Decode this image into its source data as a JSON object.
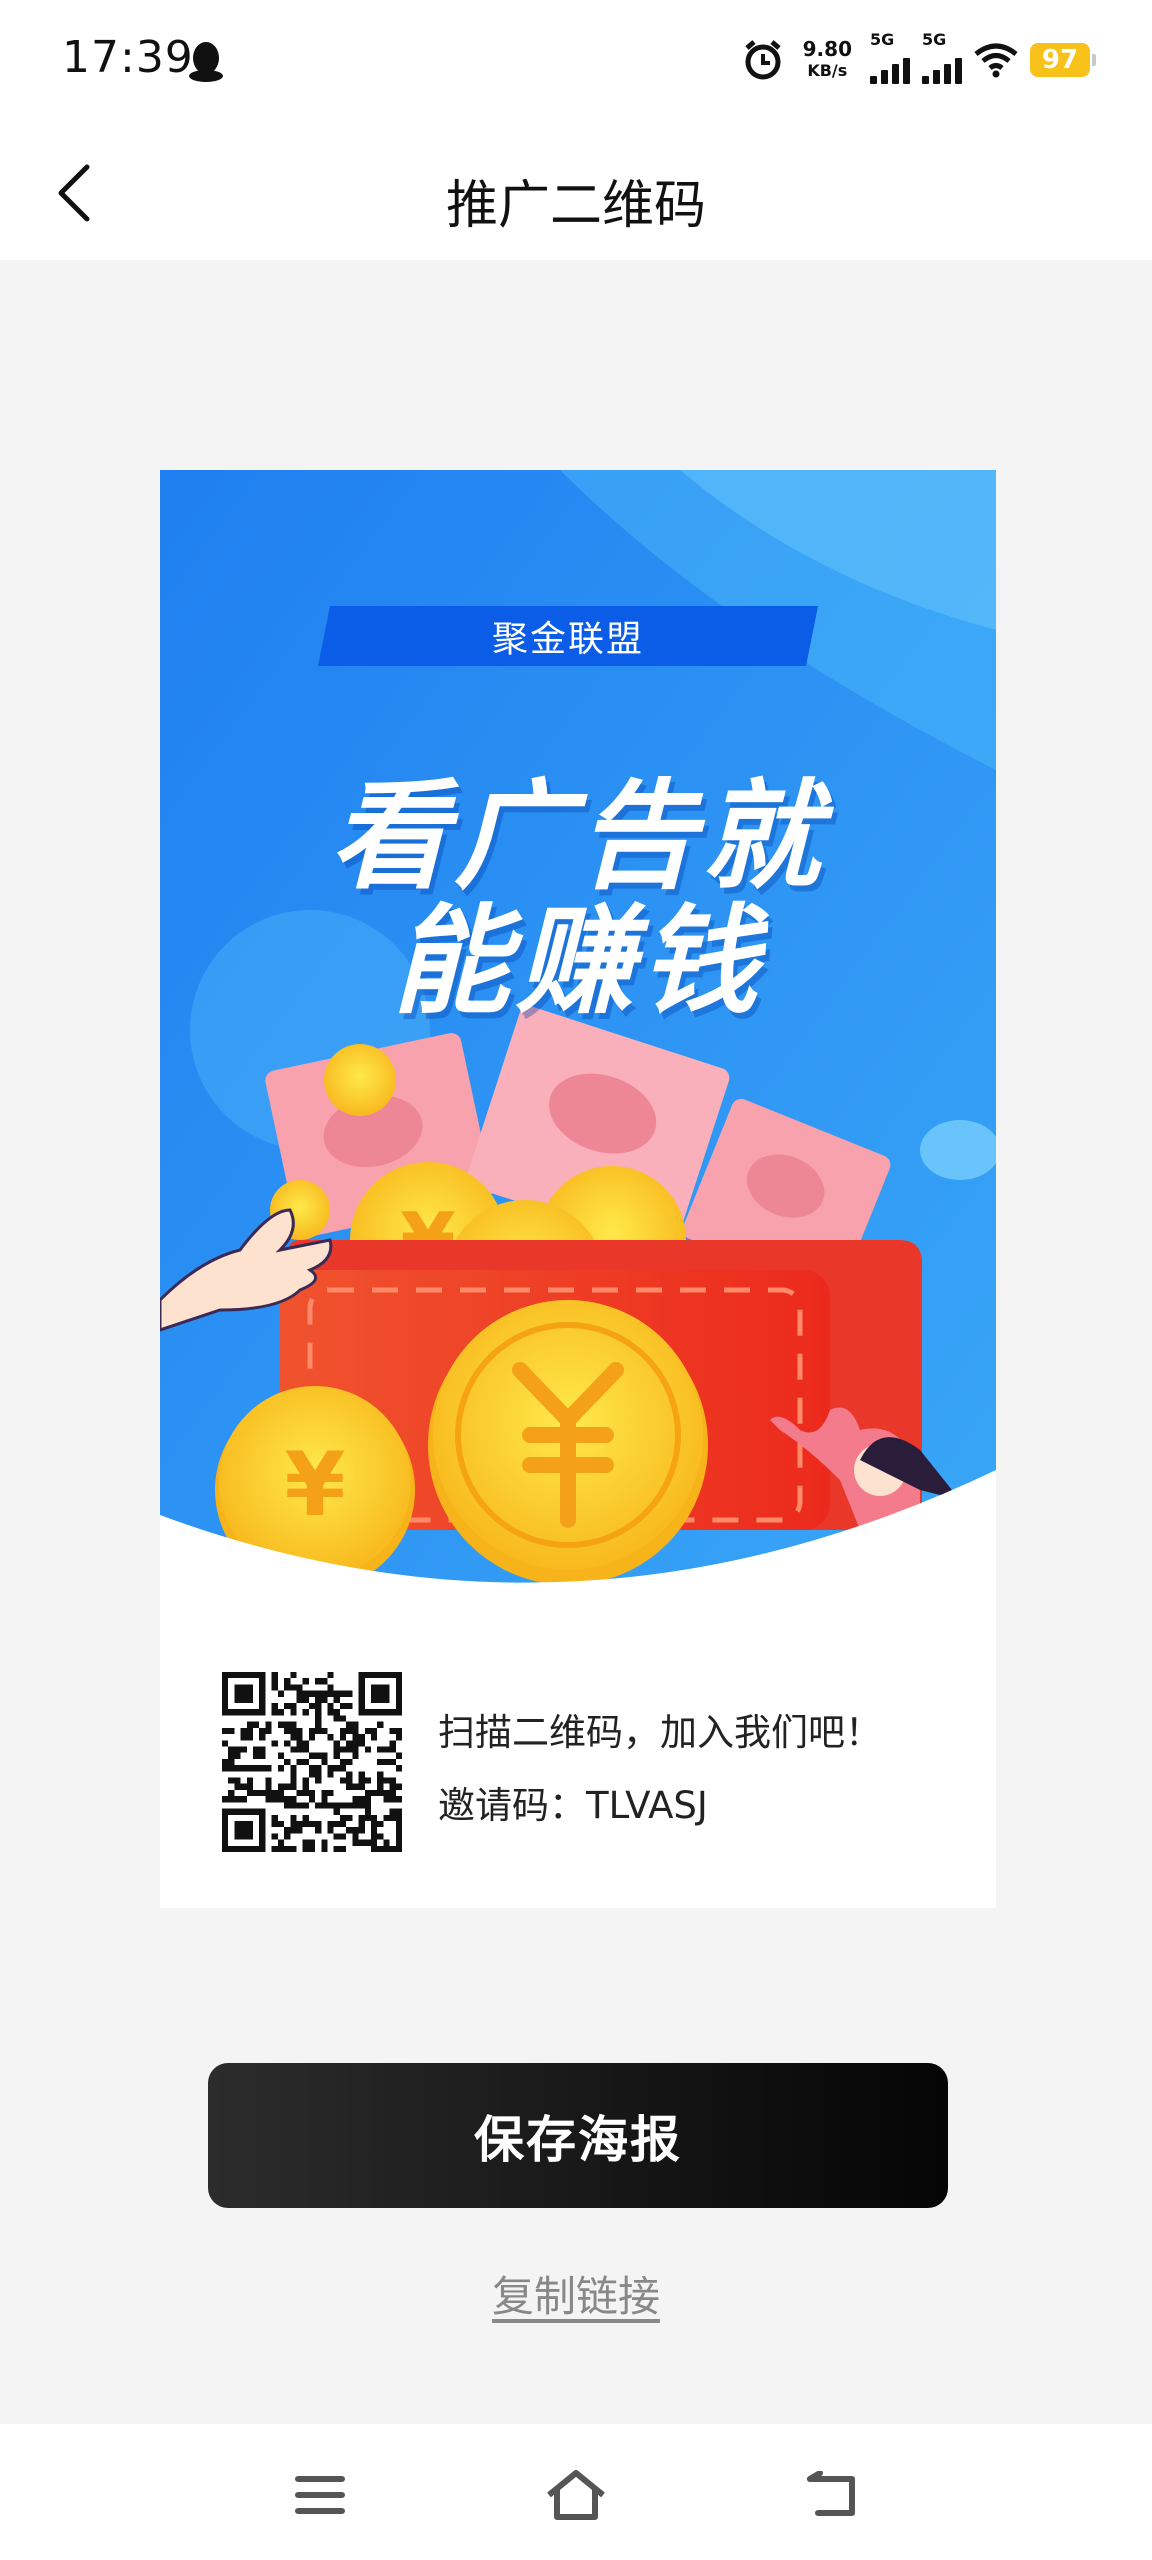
{
  "status_bar": {
    "time": "17:39",
    "net_speed_value": "9.80",
    "net_speed_unit": "KB/s",
    "sim1": "5G",
    "sim2": "5G",
    "battery": "97",
    "icons": [
      "qq-icon",
      "alarm-icon",
      "signal-icon",
      "wifi-icon",
      "battery-icon"
    ]
  },
  "navbar": {
    "title": "推广二维码"
  },
  "poster": {
    "badge": "聚金联盟",
    "headline_line1": "看广告就",
    "headline_line2": "能赚钱",
    "scan_text": "扫描二维码，加入我们吧！",
    "invite_code": "邀请码：TLVASJ"
  },
  "actions": {
    "save_label": "保存海报",
    "copy_label": "复制链接"
  },
  "colors": {
    "poster_blue": "#2d8ff0",
    "red_packet": "#f0442a",
    "coin": "#ffd12a",
    "save_button": "#111111"
  }
}
